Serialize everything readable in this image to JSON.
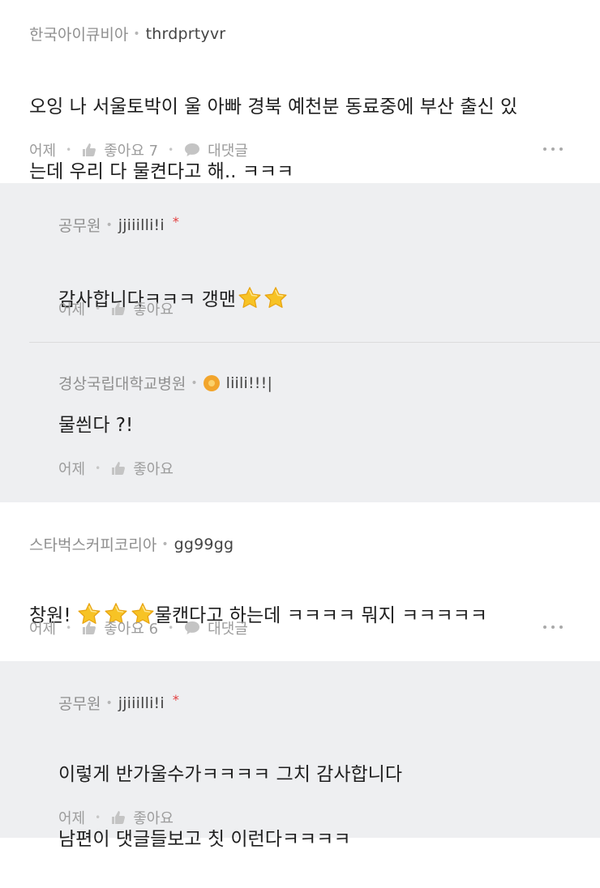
{
  "comments": [
    {
      "org": "한국아이큐비아",
      "nick": "thrdprtyvr",
      "lines": [
        "오잉 나 서울토박이 울 아빠 경북 예천분 동료중에 부산 출신 있",
        "는데 우리 다 물켠다고 해.. ㅋㅋㅋ"
      ],
      "time": "어제",
      "like_label": "좋아요 7",
      "reply_label": "대댓글",
      "replies": [
        {
          "org": "공무원",
          "nick": "jjiiilli!i",
          "text_before": "감사합니다ㅋㅋㅋ 갱맨",
          "text_after": "",
          "stars": 2,
          "time": "어제",
          "like_label": "좋아요"
        },
        {
          "org": "경상국립대학교병원",
          "nick": "liili!!!|",
          "text": "물씐다 ?!",
          "time": "어제",
          "like_label": "좋아요"
        }
      ]
    },
    {
      "org": "스타벅스커피코리아",
      "nick": "gg99gg",
      "text_before": "창원! ",
      "text_after": "물캔다고 하는데 ㅋㅋㅋㅋ 뭐지 ㅋㅋㅋㅋㅋ",
      "stars": 3,
      "time": "어제",
      "like_label": "좋아요 6",
      "reply_label": "대댓글",
      "replies": [
        {
          "org": "공무원",
          "nick": "jjiiilli!i",
          "lines": [
            "이렇게 반가울수가ㅋㅋㅋㅋ 그치 감사합니다",
            "남편이 댓글들보고 칫 이런다ㅋㅋㅋㅋ"
          ],
          "time": "어제",
          "like_label": "좋아요"
        }
      ]
    }
  ],
  "icons": {
    "like": "thumbs-up-icon",
    "reply": "speech-bubble-icon",
    "more": "more-dots-icon",
    "star": "star-emoji-icon",
    "badge": "company-badge-icon"
  },
  "colors": {
    "reply_bg": "#eeeff1",
    "star_red": "#e23d3d",
    "emoji_star": "#f7c325"
  }
}
